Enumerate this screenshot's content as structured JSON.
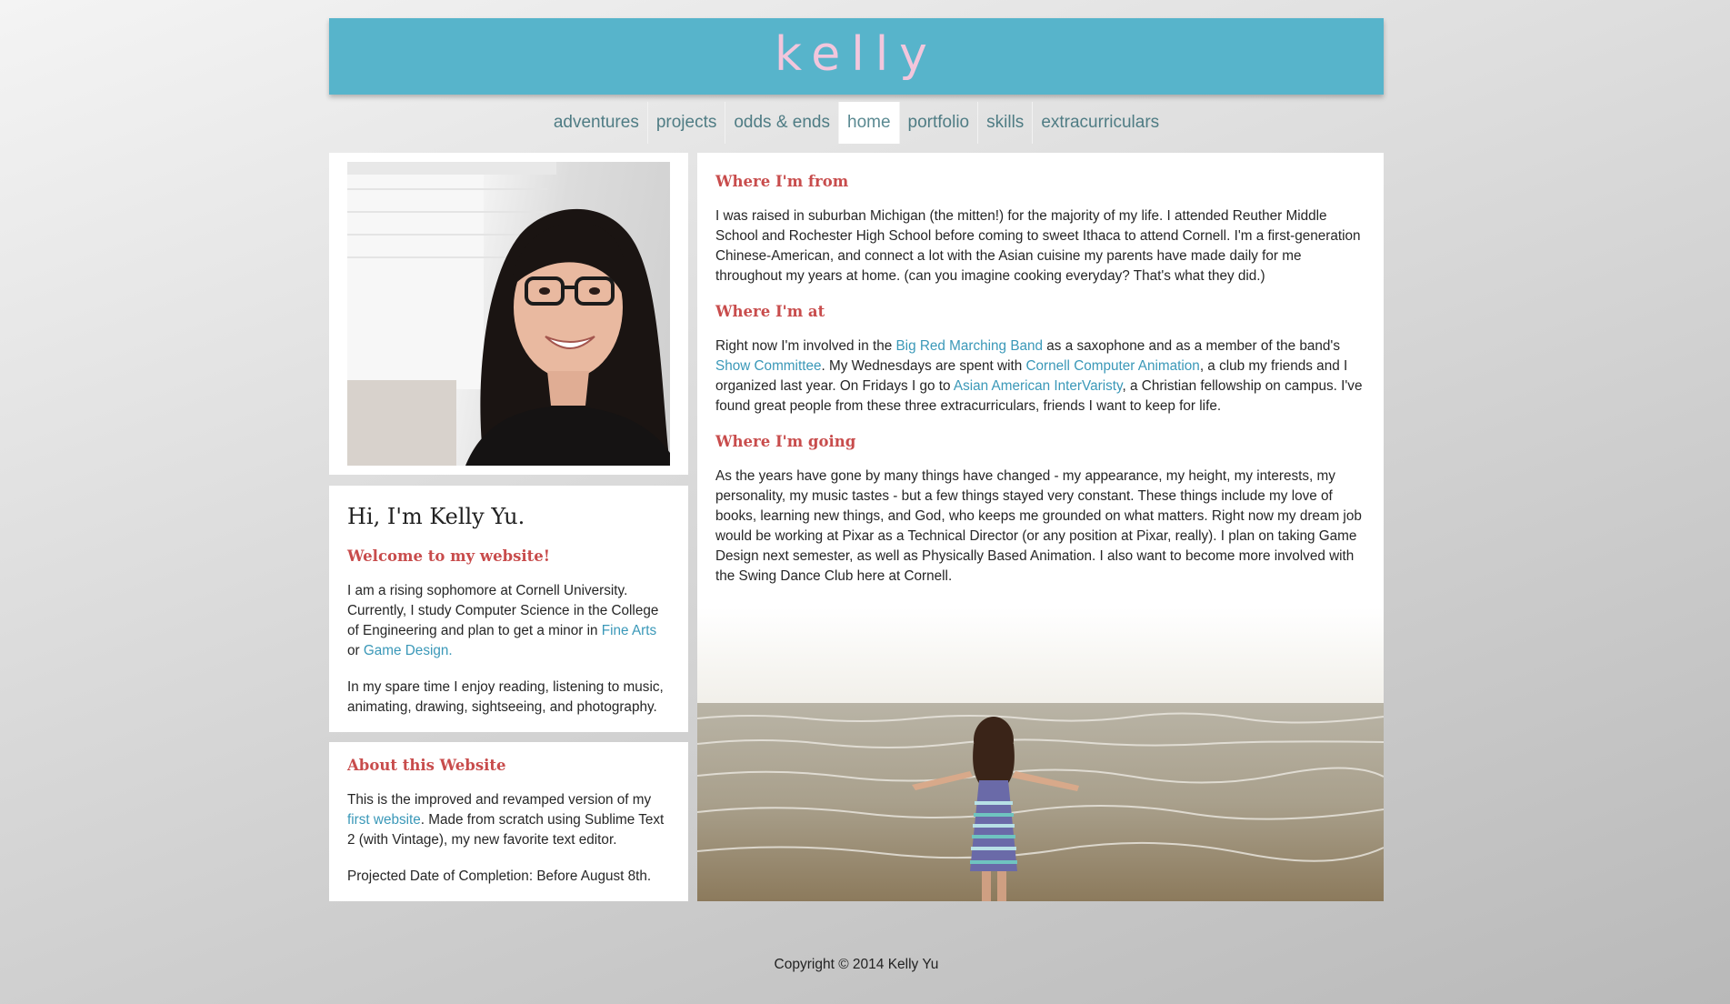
{
  "header": {
    "title": "kelly",
    "accent_color": "#57b4cb",
    "title_color": "#f2c6dc"
  },
  "nav": {
    "items": [
      {
        "label": "adventures"
      },
      {
        "label": "projects"
      },
      {
        "label": "odds & ends"
      },
      {
        "label": "home"
      },
      {
        "label": "portfolio"
      },
      {
        "label": "skills"
      },
      {
        "label": "extracurriculars"
      }
    ],
    "active": "home"
  },
  "intro": {
    "greeting": "Hi, I'm Kelly Yu.",
    "welcome": "Welcome to my website!",
    "p1_text": "I am a rising sophomore at Cornell University. Currently, I study Computer Science in the College of Engineering and plan to get a minor in ",
    "p1_link1": "Fine Arts",
    "p1_mid": " or ",
    "p1_link2": "Game Design.",
    "p2": "In my spare time I enjoy reading, listening to music, animating, drawing, sightseeing, and photography."
  },
  "about": {
    "heading": "About this Website",
    "p1_text": "This is the improved and revamped version of my ",
    "p1_link": "first website",
    "p1_rest": ". Made from scratch using Sublime Text 2 (with Vintage), my new favorite text editor.",
    "p2": "Projected Date of Completion: Before August 8th."
  },
  "main": {
    "from_heading": "Where I'm from",
    "from_text": "I was raised in suburban Michigan (the mitten!) for the majority of my life. I attended Reuther Middle School and Rochester High School before coming to sweet Ithaca to attend Cornell. I'm a first-generation Chinese-American, and connect a lot with the Asian cuisine my parents have made daily for me throughout my years at home. (can you imagine cooking everyday? That's what they did.)",
    "at_heading": "Where I'm at",
    "at_t1": "Right now I'm involved in the ",
    "at_l1": "Big Red Marching Band",
    "at_t2": " as a saxophone and as a member of the band's ",
    "at_l2": "Show Committee",
    "at_t3": ". My Wednesdays are spent with ",
    "at_l3": "Cornell Computer Animation",
    "at_t4": ", a club my friends and I organized last year. On Fridays I go to ",
    "at_l4": "Asian American InterVaristy",
    "at_t5": ", a Christian fellowship on campus. I've found great people from these three extracurriculars, friends I want to keep for life.",
    "going_heading": "Where I'm going",
    "going_text": "As the years have gone by many things have changed - my appearance, my height, my interests, my personality, my music tastes - but a few things stayed very constant. These things include my love of books, learning new things, and God, who keeps me grounded on what matters. Right now my dream job would be working at Pixar as a Technical Director (or any position at Pixar, really). I plan on taking Game Design next semester, as well as Physically Based Animation. I also want to become more involved with the Swing Dance Club here at Cornell."
  },
  "footer": {
    "copyright": "Copyright © 2014 Kelly Yu"
  },
  "colors": {
    "heading_red": "#c84c4c",
    "link_blue": "#3a98b8",
    "nav_text": "#4f7c84"
  }
}
